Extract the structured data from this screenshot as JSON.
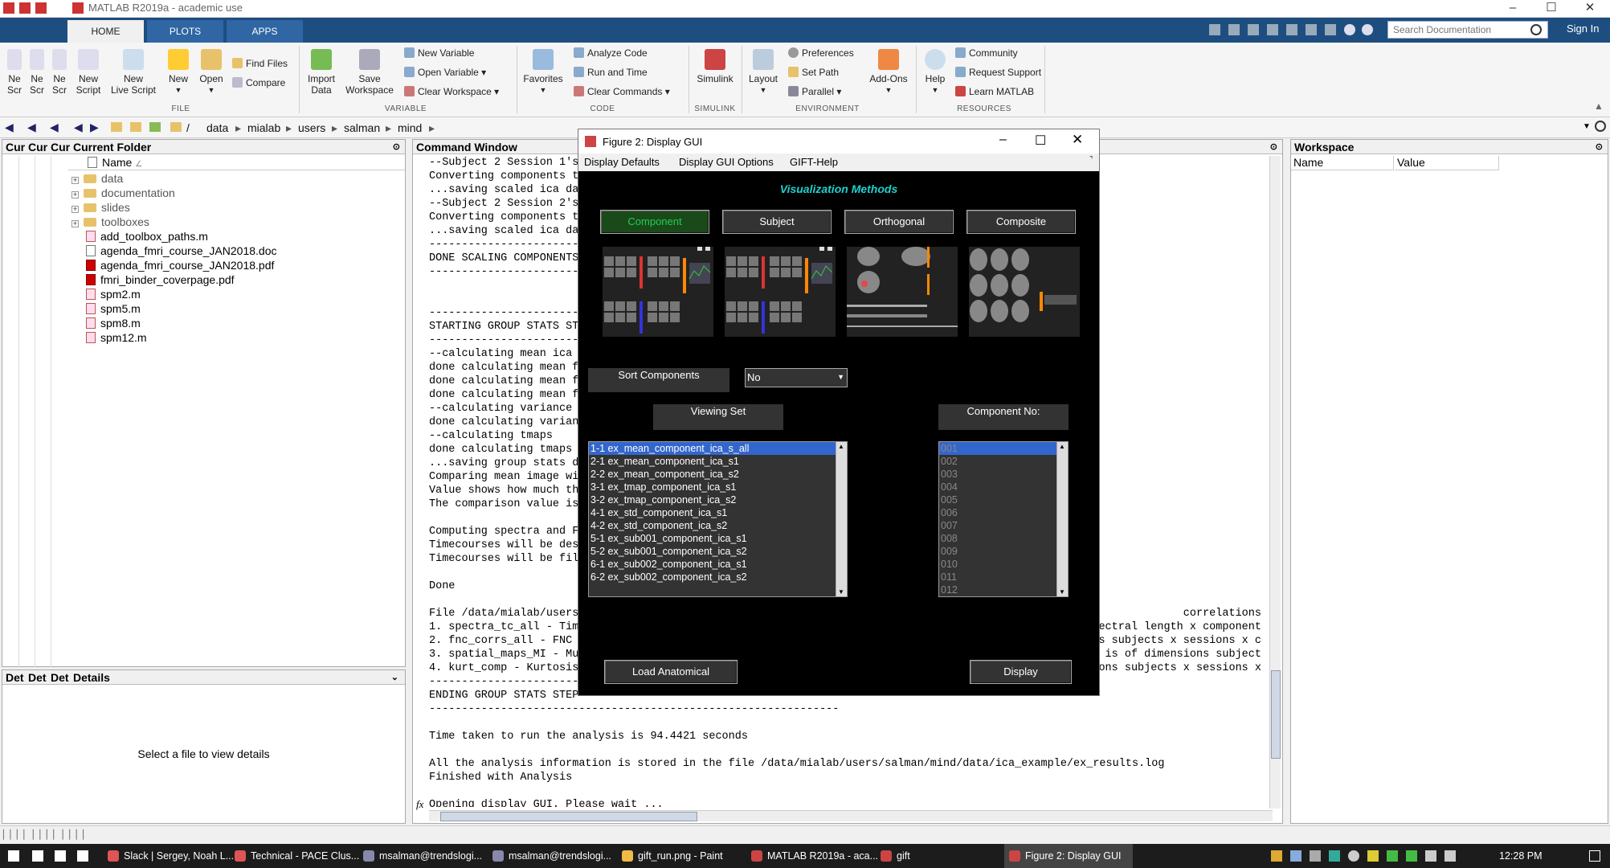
{
  "window": {
    "title": "MATLAB R2019a - academic use"
  },
  "tabs": [
    {
      "label": "HOME"
    },
    {
      "label": "PLOTS"
    },
    {
      "label": "APPS"
    }
  ],
  "search": {
    "placeholder": "Search Documentation"
  },
  "sign_in": "Sign In",
  "ribbon": {
    "file": {
      "label": "FILE",
      "new_scr1": "Ne\nScr",
      "new_scr2": "Ne\nScr",
      "new_scr3": "Ne\nScr",
      "new_script": "New\nScript",
      "new_live_script": "New\nLive Script",
      "new": "New",
      "open": "Open",
      "find_files": "Find Files",
      "compare": "Compare"
    },
    "variable": {
      "label": "VARIABLE",
      "import": "Import\nData",
      "save_ws": "Save\nWorkspace",
      "new_var": "New Variable",
      "open_var": "Open Variable ▾",
      "clear_ws": "Clear Workspace ▾"
    },
    "code": {
      "label": "CODE",
      "favorites": "Favorites",
      "analyze": "Analyze Code",
      "run_time": "Run and Time",
      "clear_cmds": "Clear Commands ▾"
    },
    "simulink": {
      "label": "SIMULINK",
      "simulink": "Simulink"
    },
    "environment": {
      "label": "ENVIRONMENT",
      "layout": "Layout",
      "prefs": "Preferences",
      "set_path": "Set Path",
      "parallel": "Parallel ▾",
      "addons": "Add-Ons"
    },
    "resources": {
      "label": "RESOURCES",
      "help": "Help",
      "community": "Community",
      "request_support": "Request Support",
      "learn": "Learn MATLAB"
    }
  },
  "address": {
    "crumbs": [
      "/",
      "data",
      "mialab",
      "users",
      "salman",
      "mind"
    ]
  },
  "current_folder": {
    "tabs": [
      "Cur",
      "Cur",
      "Cur"
    ],
    "title": "Current Folder",
    "column": "Name",
    "items": [
      {
        "name": "data",
        "type": "folder"
      },
      {
        "name": "documentation",
        "type": "folder"
      },
      {
        "name": "slides",
        "type": "folder"
      },
      {
        "name": "toolboxes",
        "type": "folder"
      },
      {
        "name": "add_toolbox_paths.m",
        "type": "m"
      },
      {
        "name": "agenda_fmri_course_JAN2018.doc",
        "type": "doc"
      },
      {
        "name": "agenda_fmri_course_JAN2018.pdf",
        "type": "pdf"
      },
      {
        "name": "fmri_binder_coverpage.pdf",
        "type": "pdf"
      },
      {
        "name": "spm2.m",
        "type": "m"
      },
      {
        "name": "spm5.m",
        "type": "m"
      },
      {
        "name": "spm8.m",
        "type": "m"
      },
      {
        "name": "spm12.m",
        "type": "m"
      }
    ]
  },
  "details": {
    "tabs": [
      "Det",
      "Det",
      "Det"
    ],
    "title": "Details",
    "empty": "Select a file to view details"
  },
  "command_window": {
    "title": "Command Window",
    "lines": [
      "--Subject 2 Session 1's",
      "Converting components t",
      "...saving scaled ica da",
      "--Subject 2 Session 2's",
      "Converting components t",
      "...saving scaled ica da",
      "---------------------------",
      "DONE SCALING COMPONENTS",
      "---------------------------",
      "",
      "",
      "---------------------------",
      "STARTING GROUP STATS ST",
      "---------------------------",
      "--calculating mean ica",
      "done calculating mean f",
      "done calculating mean f",
      "done calculating mean f",
      "--calculating variance",
      "done calculating varian",
      "--calculating tmaps",
      "done calculating tmaps",
      "...saving group stats d",
      "Comparing mean image wi",
      "Value shows how much th",
      "The comparison value is",
      "",
      "Computing spectra and F",
      "Timecourses will be des",
      "Timecourses will be fil",
      "",
      "Done",
      "",
      "File /data/mialab/users",
      "1. spectra_tc_all - Tim",
      "2. fnc_corrs_all - FNC",
      "3. spatial_maps_MI - Mu",
      "4. kurt_comp - Kurtosis",
      "---------------------------",
      "ENDING GROUP STATS STEP",
      "---------------------------------------------------------------",
      "",
      "Time taken to run the analysis is 94.4421 seconds",
      "",
      "All the analysis information is stored in the file /data/mialab/users/salman/mind/data/ica_example/ex_results.log",
      "Finished with Analysis",
      "",
      "Opening display GUI. Please wait ..."
    ],
    "right_fragments": [
      " correlations",
      "spectral length x component",
      "ons subjects x sessions x c",
      "le is of dimensions subject",
      "ons subjects x sessions x"
    ],
    "prompt": "fx"
  },
  "workspace": {
    "title": "Workspace",
    "col_name": "Name",
    "col_value": "Value"
  },
  "figure": {
    "title": "Figure 2: Display GUI",
    "menu": [
      "Display Defaults",
      "Display GUI Options",
      "GIFT-Help"
    ],
    "heading": "Visualization Methods",
    "methods": [
      "Component",
      "Subject",
      "Orthogonal",
      "Composite"
    ],
    "sort_label": "Sort Components",
    "sort_value": "No",
    "viewing_set_label": "Viewing Set",
    "component_no_label": "Component No:",
    "viewing_set": [
      "1-1 ex_mean_component_ica_s_all",
      "2-1 ex_mean_component_ica_s1",
      "2-2 ex_mean_component_ica_s2",
      "3-1 ex_tmap_component_ica_s1",
      "3-2 ex_tmap_component_ica_s2",
      "4-1 ex_std_component_ica_s1",
      "4-2 ex_std_component_ica_s2",
      "5-1 ex_sub001_component_ica_s1",
      "5-2 ex_sub001_component_ica_s2",
      "6-1 ex_sub002_component_ica_s1",
      "6-2 ex_sub002_component_ica_s2"
    ],
    "components": [
      "001",
      "002",
      "003",
      "004",
      "005",
      "006",
      "007",
      "008",
      "009",
      "010",
      "011",
      "012"
    ],
    "load_anatomical": "Load Anatomical",
    "display": "Display",
    "colors": {
      "heading": "#20d0d0",
      "active": "#22cc55",
      "selection": "#3366cc"
    }
  },
  "taskbar": {
    "items": [
      {
        "label": "Slack | Sergey, Noah L..."
      },
      {
        "label": "Technical - PACE Clus..."
      },
      {
        "label": "msalman@trendslogi..."
      },
      {
        "label": "msalman@trendslogi..."
      },
      {
        "label": "gift_run.png - Paint"
      },
      {
        "label": "MATLAB R2019a - aca..."
      },
      {
        "label": "gift"
      },
      {
        "label": "Figure 2: Display GUI"
      }
    ],
    "clock": "12:28 PM"
  }
}
